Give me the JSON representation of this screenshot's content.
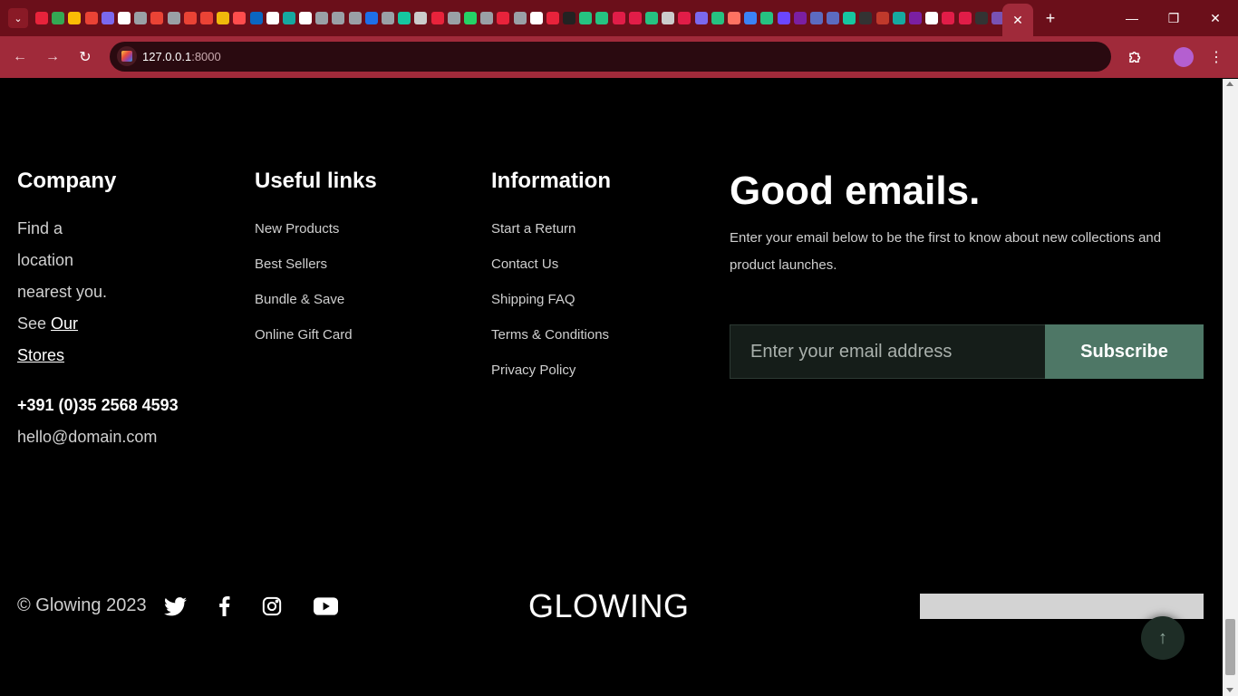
{
  "browser": {
    "url_host": "127.0.0.1",
    "url_port": ":8000",
    "favicon_colors": [
      "#e8233b",
      "#34a853",
      "#fbbc05",
      "#ea4335",
      "#7b68ee",
      "#ffffff",
      "#9aa0a6",
      "#ea4335",
      "#9aa0a6",
      "#ea4335",
      "#ea4335",
      "#f0b90b",
      "#ff4d4d",
      "#0a66c2",
      "#ffffff",
      "#16a9a0",
      "#ffffff",
      "#9aa0a6",
      "#9aa0a6",
      "#9aa0a6",
      "#1e6fe8",
      "#9aa0a6",
      "#16c6a0",
      "#cccccc",
      "#e8233b",
      "#9aa0a6",
      "#25d366",
      "#9aa0a6",
      "#e8233b",
      "#9aa0a6",
      "#ffffff",
      "#e8233b",
      "#222222",
      "#26c281",
      "#26c281",
      "#e11d48",
      "#e11d48",
      "#26c281",
      "#cccccc",
      "#e11d48",
      "#7b68ee",
      "#26c281",
      "#ff7262",
      "#3b82f6",
      "#26c281",
      "#6b46ff",
      "#7b1fa2",
      "#5c6bc0",
      "#5c6bc0",
      "#16c6a0",
      "#333333",
      "#c0392b",
      "#16a9a0",
      "#7b1fa2",
      "#ffffff",
      "#e11d48",
      "#e11d48",
      "#333333",
      "#7952b3"
    ],
    "active_tab_close": "✕",
    "new_tab": "+",
    "window_minimize": "—",
    "window_restore": "❐",
    "window_close": "✕"
  },
  "footer": {
    "company": {
      "title": "Company",
      "line1": "Find a",
      "line2": "location",
      "line3": "nearest you.",
      "line4_prefix": "See ",
      "line4_link": "Our",
      "line5_link": "Stores",
      "phone": "+391 (0)35 2568 4593",
      "email": "hello@domain.com"
    },
    "useful_links": {
      "title": "Useful links",
      "items": [
        "New Products",
        "Best Sellers",
        "Bundle & Save",
        "Online Gift Card"
      ]
    },
    "information": {
      "title": "Information",
      "items": [
        "Start a Return",
        "Contact Us",
        "Shipping FAQ",
        "Terms & Conditions",
        "Privacy Policy"
      ]
    },
    "newsletter": {
      "title": "Good emails.",
      "description": "Enter your email below to be the first to know about new collections and product launches.",
      "placeholder": "Enter your email address",
      "button": "Subscribe"
    },
    "copyright": "© Glowing 2023",
    "social": [
      "twitter-icon",
      "facebook-icon",
      "instagram-icon",
      "youtube-icon"
    ],
    "logo": "GLOWING",
    "back_to_top": "↑"
  }
}
